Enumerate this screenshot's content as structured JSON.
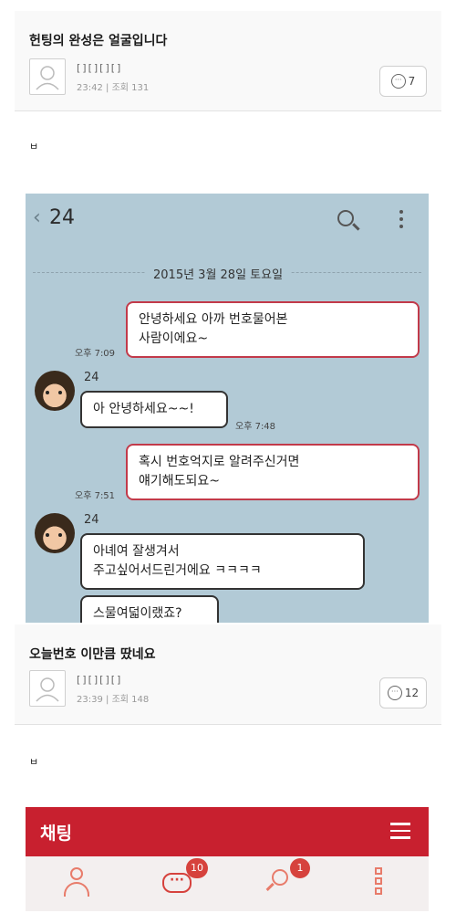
{
  "posts": [
    {
      "title": "헌팅의 완성은 얼굴입니다",
      "author": "[][][][]",
      "time": "23:42",
      "views_label": "조회 131",
      "comments": "7",
      "body_char": "ㅂ"
    },
    {
      "title": "오늘번호 이만큼 땄네요",
      "author": "[][][][]",
      "time": "23:39",
      "views_label": "조회 148",
      "comments": "12",
      "body_char": "ㅂ"
    }
  ],
  "chat": {
    "back_icon": "chevron-left-icon",
    "room_title": "24",
    "date": "2015년 3월 28일 토요일",
    "friend_name": "24",
    "messages": [
      {
        "from": "me",
        "text_line1": "안녕하세요 아까 번호물어본",
        "text_line2": "사람이에요~",
        "time": "오후 7:09"
      },
      {
        "from": "them",
        "text": "아 안녕하세요~~!",
        "time": "오후 7:48"
      },
      {
        "from": "me",
        "text_line1": "혹시 번호억지로 알려주신거면",
        "text_line2": "얘기해도되요~",
        "time": "오후 7:51"
      },
      {
        "from": "them",
        "text_line1": "아녜여 잘생겨서",
        "text_line2": "주고싶어서드린거에요 ㅋㅋㅋㅋ"
      },
      {
        "from": "them",
        "text": "스물여덟이랬죠?"
      }
    ]
  },
  "app": {
    "title": "채팅",
    "accent_color": "#c8202f",
    "tabs": [
      {
        "icon": "person-icon"
      },
      {
        "icon": "chat-bubble-icon",
        "badge": "10"
      },
      {
        "icon": "search-icon",
        "badge": "1"
      },
      {
        "icon": "more-icon"
      }
    ]
  }
}
